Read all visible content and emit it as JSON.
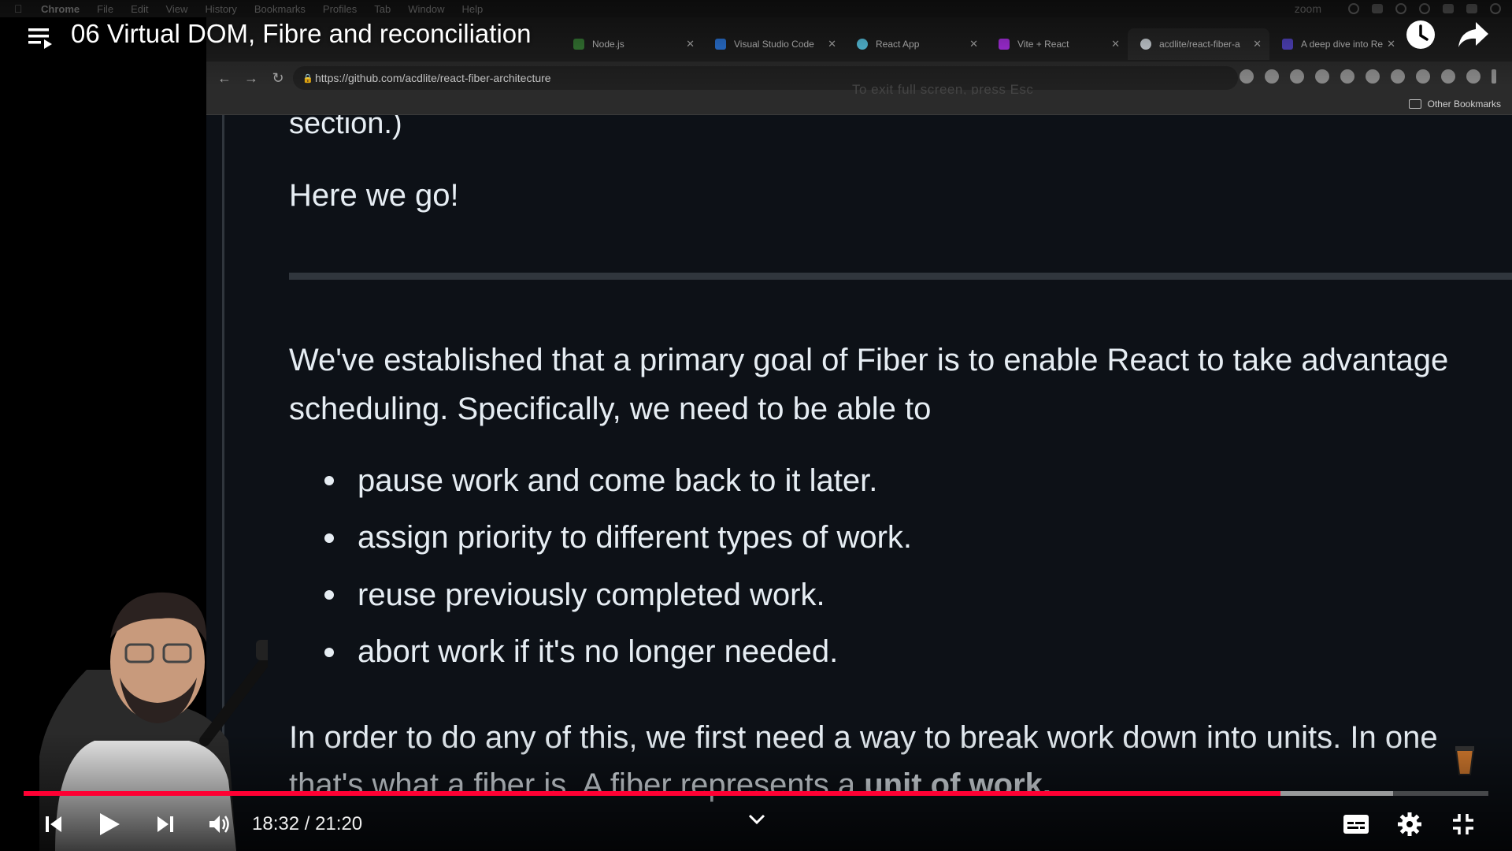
{
  "video": {
    "title": "06 Virtual DOM, Fibre and reconciliation",
    "current_time": "18:32",
    "duration": "21:20",
    "time_separator": " / ",
    "progress_played_fraction": 0.858,
    "progress_buffered_fraction": 0.935
  },
  "mac_menubar": {
    "items": [
      "Chrome",
      "File",
      "Edit",
      "View",
      "History",
      "Bookmarks",
      "Profiles",
      "Tab",
      "Window",
      "Help"
    ],
    "zoom_label": "zoom"
  },
  "browser": {
    "tabs": [
      {
        "label": "Node.js",
        "color": "#3c873a"
      },
      {
        "label": "Visual Studio Code",
        "color": "#2f80ed"
      },
      {
        "label": "React App",
        "color": "#61dafb"
      },
      {
        "label": "Vite + React",
        "color": "#bd34fe"
      },
      {
        "label": "acdlite/react-fiber-a",
        "color": "#e6edf3"
      },
      {
        "label": "A deep dive into Re",
        "color": "#5b4bd6"
      }
    ],
    "url": "https://github.com/acdlite/react-fiber-architecture",
    "fullscreen_hint": "To exit full screen, press  Esc",
    "bookmarks_other": "Other Bookmarks"
  },
  "readme": {
    "section_tail": "section.)",
    "here_we_go": "Here we go!",
    "para1_line1": "We've established that a primary goal of Fiber is to enable React to take advantage",
    "para1_line2": "scheduling. Specifically, we need to be able to",
    "bullets": [
      "pause work and come back to it later.",
      "assign priority to different types of work.",
      "reuse previously completed work.",
      "abort work if it's no longer needed."
    ],
    "para2_line1": "In order to do any of this, we first need a way to break work down into units. In one",
    "para2_line2_start": "that's what a fiber is. A fiber represents a ",
    "para2_line2_bold": "unit of work."
  },
  "colors": {
    "accent_red": "#ff0033",
    "github_bg": "#0d1117",
    "github_text": "#e6edf3"
  }
}
